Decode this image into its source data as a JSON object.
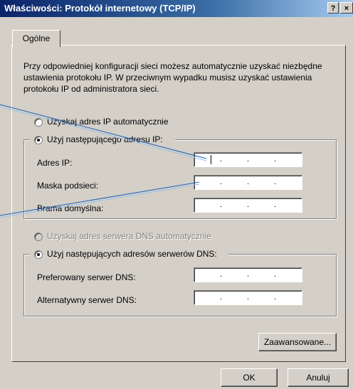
{
  "window": {
    "title": "Właściwości: Protokół internetowy (TCP/IP)",
    "help_button": "?",
    "close_button": "×"
  },
  "tabs": [
    {
      "label": "Ogólne"
    }
  ],
  "description": "Przy odpowiedniej konfiguracji sieci możesz automatycznie uzyskać niezbędne ustawienia protokołu IP. W przeciwnym wypadku musisz uzyskać ustawienia protokołu IP od administratora sieci.",
  "ip_section": {
    "auto_option": "Uzyskaj adres IP automatycznie",
    "manual_option": "Użyj następującego adresu IP:",
    "selected": "manual",
    "fields": [
      {
        "label": "Adres IP:",
        "value": " .   .   . "
      },
      {
        "label": "Maska podsieci:",
        "value": " .   .   . "
      },
      {
        "label": "Brama domyślna:",
        "value": " .   .   . "
      }
    ]
  },
  "dns_section": {
    "auto_option": "Uzyskaj adres serwera DNS automatycznie",
    "manual_option": "Użyj następujących adresów serwerów DNS:",
    "selected": "manual",
    "fields": [
      {
        "label": "Preferowany serwer DNS:",
        "value": ""
      },
      {
        "label": "Alternatywny serwer DNS:",
        "value": ""
      }
    ]
  },
  "buttons": {
    "advanced": "Zaawansowane...",
    "ok": "OK",
    "cancel": "Anuluj"
  },
  "colors": {
    "titlebar_start": "#0a246a",
    "titlebar_end": "#a6caf0",
    "window_bg": "#d4d0c8",
    "annotation_line": "#3a7abf"
  }
}
